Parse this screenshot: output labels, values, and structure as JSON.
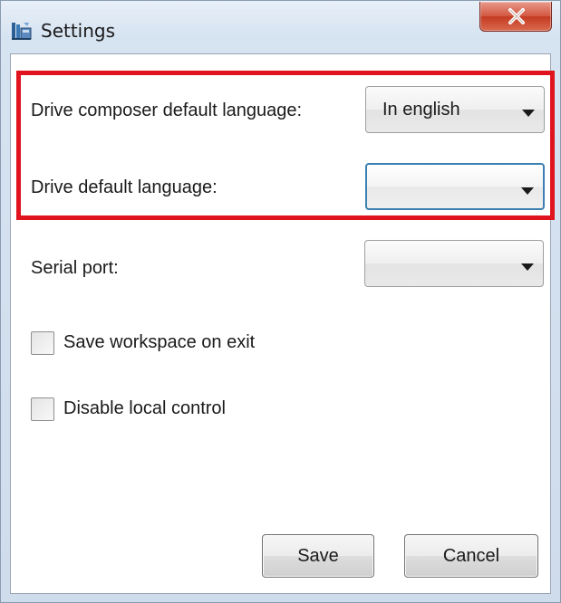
{
  "window": {
    "title": "Settings",
    "close_label": "X"
  },
  "fields": {
    "composer_language_label": "Drive composer default language:",
    "composer_language_value": "In english",
    "drive_language_label": "Drive default language:",
    "drive_language_value": "",
    "serial_port_label": "Serial port:",
    "serial_port_value": ""
  },
  "checkboxes": {
    "save_workspace_label": "Save workspace on exit",
    "save_workspace_checked": false,
    "disable_local_control_label": "Disable local control",
    "disable_local_control_checked": false
  },
  "buttons": {
    "save_label": "Save",
    "cancel_label": "Cancel"
  },
  "colors": {
    "highlight": "#e0141e",
    "focus_border": "#3c7fb1",
    "close_button": "#c43b22"
  },
  "icons": {
    "app": "settings-app-icon",
    "close": "close-icon",
    "dropdown": "chevron-down-icon"
  }
}
